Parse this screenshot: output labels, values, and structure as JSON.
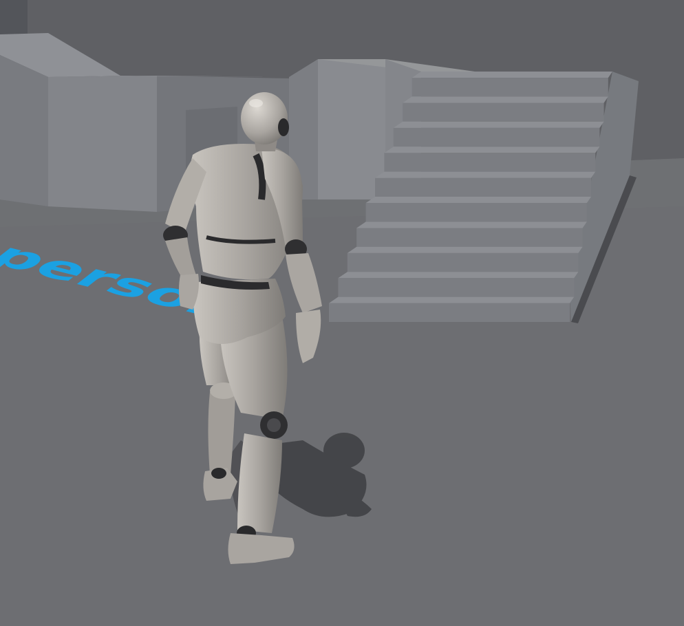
{
  "scene": {
    "floor_text": "person",
    "colors": {
      "sky": "#5f6064",
      "floor": "#6d6e72",
      "floor_far": "#707175",
      "block_light": "#8a8c91",
      "block_mid": "#7f8186",
      "block_dark": "#74767b",
      "stair_tread": "#8d8f94",
      "stair_riser": "#7b7d82",
      "stair_side": "#777a7f",
      "floor_text": "#1ba1e2",
      "mannequin": "#a9a6a1",
      "mannequin_shade": "#7e7b77",
      "joint": "#2a2a2c",
      "shadow": "#3c3d40"
    }
  }
}
